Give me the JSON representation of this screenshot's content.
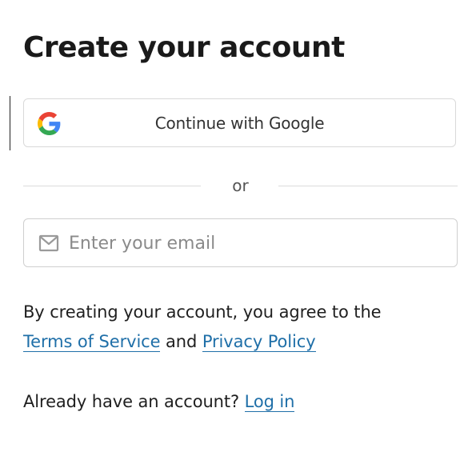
{
  "page": {
    "title": "Create your account"
  },
  "google": {
    "label": "Continue with Google",
    "icon": "google-icon"
  },
  "divider": {
    "text": "or"
  },
  "email": {
    "placeholder": "Enter your email",
    "value": "",
    "icon": "mail-icon"
  },
  "terms": {
    "prefix": "By creating your account, you agree to the",
    "tos_link": "Terms of Service",
    "and": "and",
    "privacy_link": "Privacy Policy"
  },
  "login": {
    "prompt": "Already have an account?",
    "link": "Log in"
  },
  "colors": {
    "link": "#1f6fa8",
    "border": "#d9d9d9",
    "text": "#1f1f1f"
  }
}
